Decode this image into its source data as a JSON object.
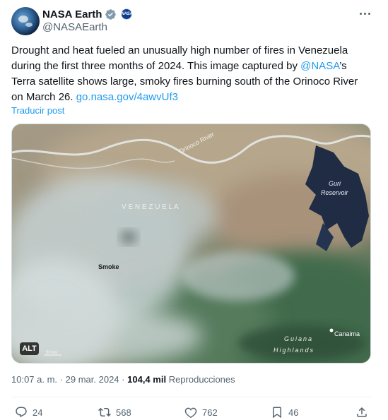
{
  "author": {
    "display_name": "NASA Earth",
    "handle": "@NASAEarth",
    "affiliate_icon": "nasa-meatball-logo"
  },
  "post": {
    "text_before_mention": "Drought and heat fueled an unusually high number of fires in Venezuela during the first three months of 2024. This image captured by ",
    "mention": "@NASA",
    "text_after_mention": "’s Terra satellite shows large, smoky fires burning south of the Orinoco River on March 26. ",
    "link": "go.nasa.gov/4awvUf3",
    "translate_label": "Traducir post"
  },
  "media": {
    "labels": {
      "river": "Orinoco River",
      "country": "V E N E Z U E L A",
      "reservoir_line1": "Guri",
      "reservoir_line2": "Reservoir",
      "smoke": "Smoke",
      "town": "Canaima",
      "highlands_line1": "Guiana",
      "highlands_line2": "Highlands",
      "scale": "50 km"
    },
    "alt_label": "ALT"
  },
  "meta": {
    "time": "10:07 a. m.",
    "date": "29 mar. 2024",
    "views": "104,4 mil",
    "views_label": "Reproducciones",
    "separator": "·"
  },
  "actions": {
    "replies": "24",
    "reposts": "568",
    "likes": "762",
    "bookmarks": "46"
  },
  "colors": {
    "accent": "#1d9bf0",
    "secondary_text": "#536471",
    "verified_badge": "#829aab"
  }
}
